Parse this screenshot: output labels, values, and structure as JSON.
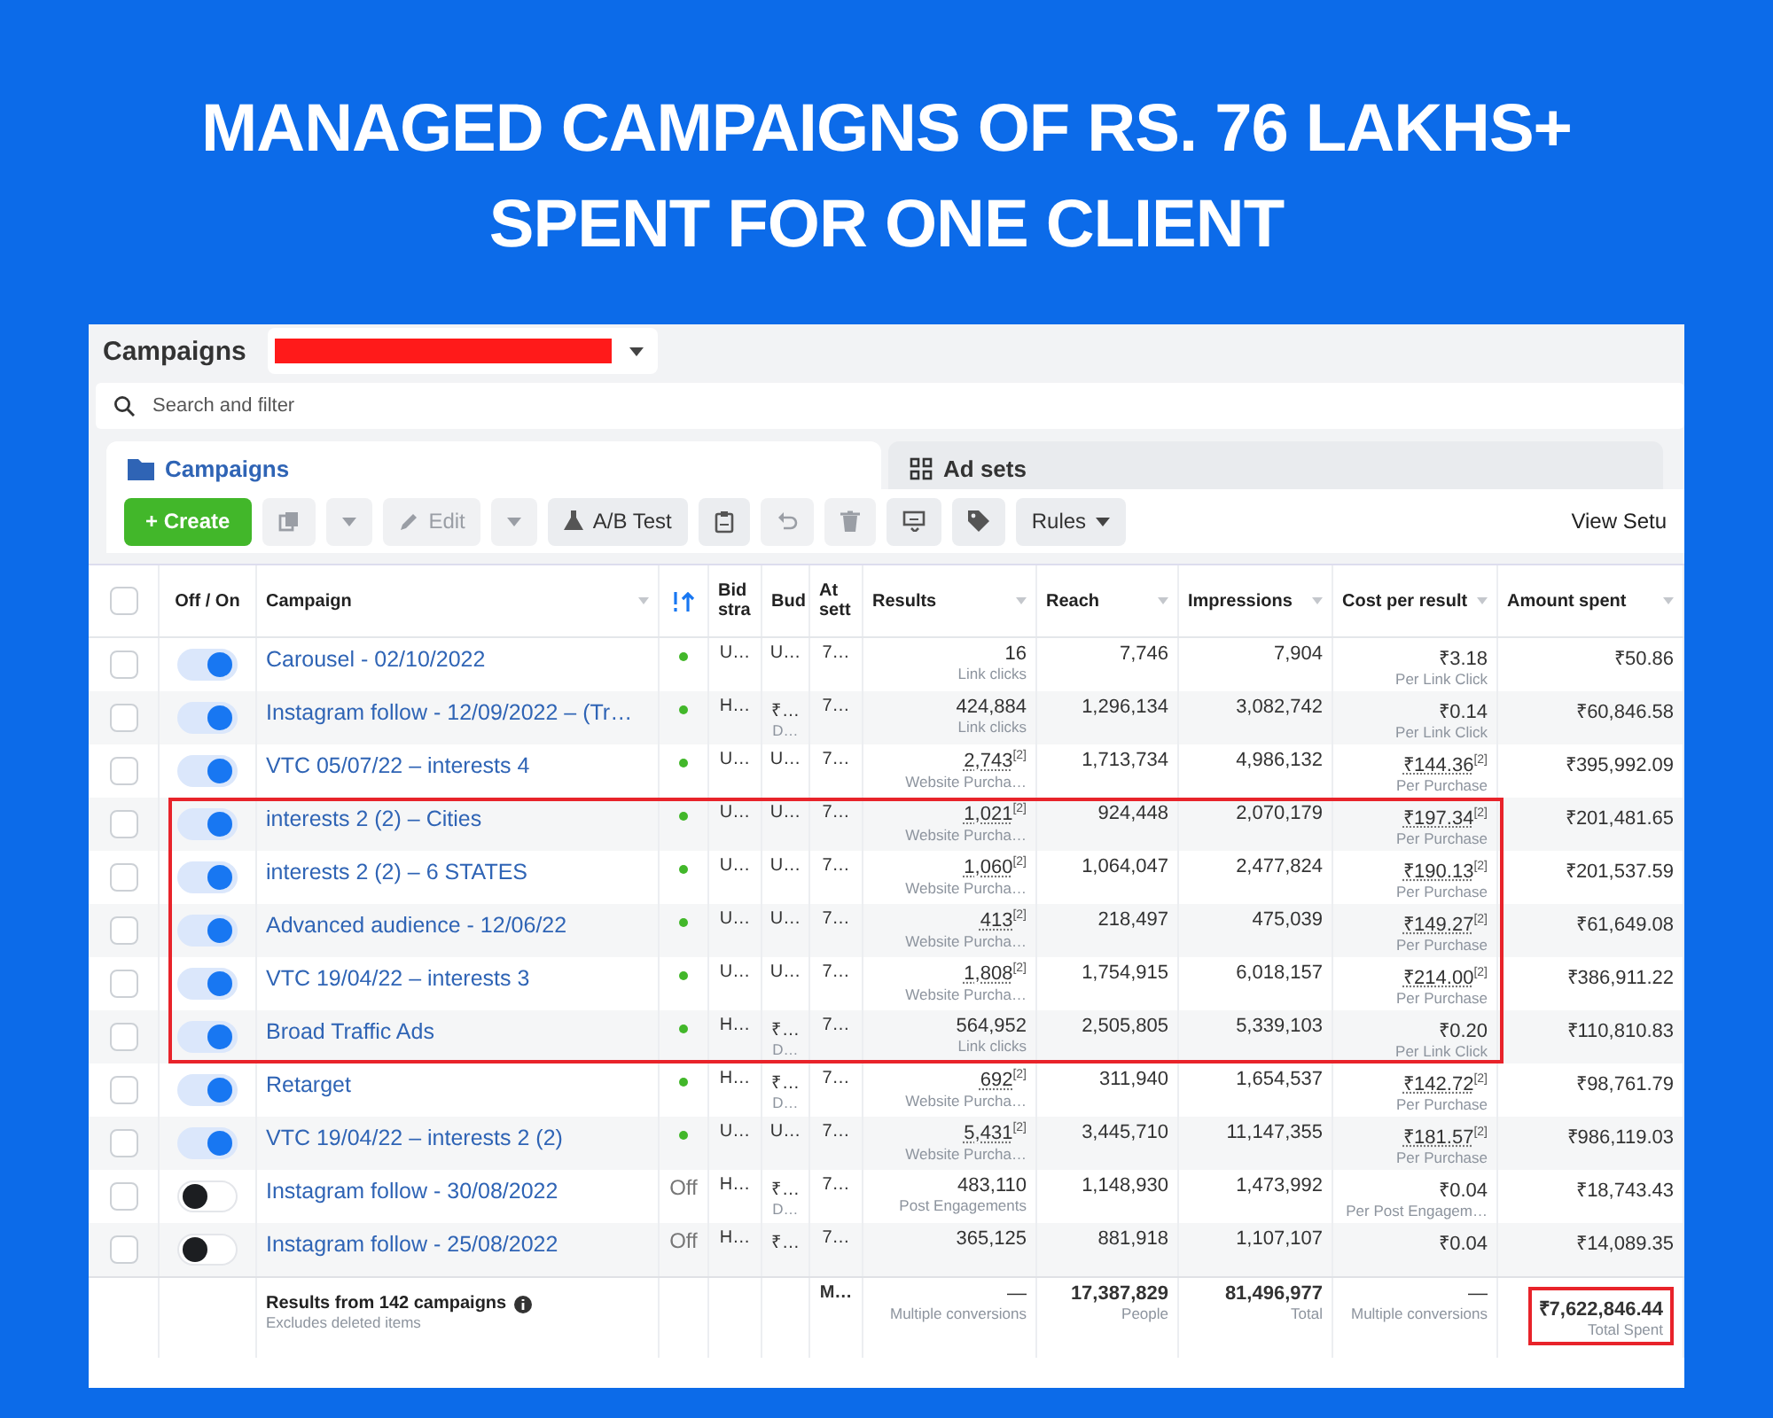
{
  "title_lines": [
    "MANAGED CAMPAIGNS OF RS. 76 LAKHS+",
    "SPENT FOR ONE CLIENT"
  ],
  "header": {
    "title": "Campaigns"
  },
  "search": {
    "placeholder": "Search and filter"
  },
  "tabs": [
    {
      "label": "Campaigns",
      "kind": "folder",
      "selected": true
    },
    {
      "label": "Ad sets",
      "kind": "grid",
      "selected": false
    }
  ],
  "toolbar": [
    {
      "kind": "create",
      "label": "+ Create",
      "disabled": false
    },
    {
      "kind": "copy",
      "disabled": true
    },
    {
      "kind": "caret",
      "disabled": true
    },
    {
      "kind": "edit",
      "label": "Edit",
      "disabled": true
    },
    {
      "kind": "caret",
      "disabled": true
    },
    {
      "kind": "abtest",
      "label": "A/B Test",
      "disabled": false
    },
    {
      "kind": "clipboard",
      "disabled": false
    },
    {
      "kind": "undo",
      "disabled": true
    },
    {
      "kind": "delete",
      "disabled": true
    },
    {
      "kind": "preview",
      "disabled": false
    },
    {
      "kind": "tag",
      "disabled": false
    },
    {
      "kind": "rules",
      "label": "Rules",
      "disabled": false
    }
  ],
  "view_setup": "View Setu",
  "select_all_checked": false,
  "columns": [
    "Off / On",
    "Campaign",
    "Bid stra",
    "Bud",
    "At sett",
    "Results",
    "Reach",
    "Impressions",
    "Cost per result",
    "Amount spent"
  ],
  "rows": [
    {
      "checked": false,
      "on": true,
      "highlighted": false,
      "name": "Carousel - 02/10/2022",
      "bid": "U…",
      "budget": "U…",
      "attr": "7…",
      "results": "16",
      "results_sub": "Link clicks",
      "reach": "7,746",
      "impressions": "7,904",
      "cost": "₹3.18",
      "cost_sub": "Per Link Click",
      "amount": "₹50.86"
    },
    {
      "checked": false,
      "on": true,
      "highlighted": false,
      "name": "Instagram follow - 12/09/2022 – (Tr…",
      "bid": "H…",
      "budget": "₹…",
      "budget_sub": "D…",
      "attr": "7…",
      "results": "424,884",
      "results_sub": "Link clicks",
      "reach": "1,296,134",
      "impressions": "3,082,742",
      "cost": "₹0.14",
      "cost_sub": "Per Link Click",
      "amount": "₹60,846.58"
    },
    {
      "checked": false,
      "on": true,
      "highlighted": false,
      "name": "VTC 05/07/22 – interests 4",
      "bid": "U…",
      "budget": "U…",
      "attr": "7…",
      "results": "2,743",
      "note": "[2]",
      "results_sub": "Website Purcha…",
      "reach": "1,713,734",
      "impressions": "4,986,132",
      "cost": "₹144.36",
      "cost_note": "[2]",
      "cost_sub": "Per Purchase",
      "amount": "₹395,992.09"
    },
    {
      "checked": false,
      "on": true,
      "highlighted": true,
      "name": "interests 2 (2) – Cities",
      "bid": "U…",
      "budget": "U…",
      "attr": "7…",
      "results": "1,021",
      "note": "[2]",
      "results_sub": "Website Purcha…",
      "reach": "924,448",
      "impressions": "2,070,179",
      "cost": "₹197.34",
      "cost_note": "[2]",
      "cost_sub": "Per Purchase",
      "amount": "₹201,481.65"
    },
    {
      "checked": false,
      "on": true,
      "highlighted": true,
      "name": "interests 2 (2) – 6 STATES",
      "bid": "U…",
      "budget": "U…",
      "attr": "7…",
      "results": "1,060",
      "note": "[2]",
      "results_sub": "Website Purcha…",
      "reach": "1,064,047",
      "impressions": "2,477,824",
      "cost": "₹190.13",
      "cost_note": "[2]",
      "cost_sub": "Per Purchase",
      "amount": "₹201,537.59"
    },
    {
      "checked": false,
      "on": true,
      "highlighted": true,
      "name": "Advanced audience - 12/06/22",
      "bid": "U…",
      "budget": "U…",
      "attr": "7…",
      "results": "413",
      "note": "[2]",
      "results_sub": "Website Purcha…",
      "reach": "218,497",
      "impressions": "475,039",
      "cost": "₹149.27",
      "cost_note": "[2]",
      "cost_sub": "Per Purchase",
      "amount": "₹61,649.08"
    },
    {
      "checked": false,
      "on": true,
      "highlighted": true,
      "name": "VTC 19/04/22 – interests 3",
      "bid": "U…",
      "budget": "U…",
      "attr": "7…",
      "results": "1,808",
      "note": "[2]",
      "results_sub": "Website Purcha…",
      "reach": "1,754,915",
      "impressions": "6,018,157",
      "cost": "₹214.00",
      "cost_note": "[2]",
      "cost_sub": "Per Purchase",
      "amount": "₹386,911.22"
    },
    {
      "checked": false,
      "on": true,
      "highlighted": true,
      "name": "Broad Traffic Ads",
      "bid": "H…",
      "budget": "₹…",
      "budget_sub": "D…",
      "attr": "7…",
      "results": "564,952",
      "results_sub": "Link clicks",
      "reach": "2,505,805",
      "impressions": "5,339,103",
      "cost": "₹0.20",
      "cost_sub": "Per Link Click",
      "amount": "₹110,810.83"
    },
    {
      "checked": false,
      "on": true,
      "highlighted": false,
      "name": "Retarget",
      "bid": "H…",
      "budget": "₹…",
      "budget_sub": "D…",
      "attr": "7…",
      "results": "692",
      "note": "[2]",
      "results_sub": "Website Purcha…",
      "reach": "311,940",
      "impressions": "1,654,537",
      "cost": "₹142.72",
      "cost_note": "[2]",
      "cost_sub": "Per Purchase",
      "amount": "₹98,761.79"
    },
    {
      "checked": false,
      "on": true,
      "highlighted": false,
      "name": "VTC 19/04/22 – interests 2 (2)",
      "bid": "U…",
      "budget": "U…",
      "attr": "7…",
      "results": "5,431",
      "note": "[2]",
      "results_sub": "Website Purcha…",
      "reach": "3,445,710",
      "impressions": "11,147,355",
      "cost": "₹181.57",
      "cost_note": "[2]",
      "cost_sub": "Per Purchase",
      "amount": "₹986,119.03"
    },
    {
      "checked": false,
      "on": false,
      "highlighted": false,
      "name": "Instagram follow - 30/08/2022",
      "delivery": "Off",
      "bid": "H…",
      "budget": "₹…",
      "budget_sub": "D…",
      "attr": "7…",
      "results": "483,110",
      "results_sub": "Post Engagements",
      "reach": "1,148,930",
      "impressions": "1,473,992",
      "cost": "₹0.04",
      "cost_sub": "Per Post Engagem…",
      "amount": "₹18,743.43"
    },
    {
      "checked": false,
      "on": false,
      "highlighted": false,
      "name": "Instagram follow - 25/08/2022",
      "delivery": "Off",
      "bid": "H…",
      "budget": "₹…",
      "attr": "7…",
      "results": "365,125",
      "reach": "881,918",
      "impressions": "1,107,107",
      "cost": "₹0.04",
      "amount": "₹14,089.35"
    }
  ],
  "footer": {
    "title": "Results from 142 campaigns",
    "subtitle": "Excludes deleted items",
    "attr": "M…",
    "results": "—",
    "results_sub": "Multiple conversions",
    "reach": "17,387,829",
    "reach_sub": "People",
    "impressions": "81,496,977",
    "impressions_sub": "Total",
    "cost": "—",
    "cost_sub": "Multiple conversions",
    "amount": "₹7,622,846.44",
    "amount_sub": "Total Spent",
    "highlighted": true
  }
}
